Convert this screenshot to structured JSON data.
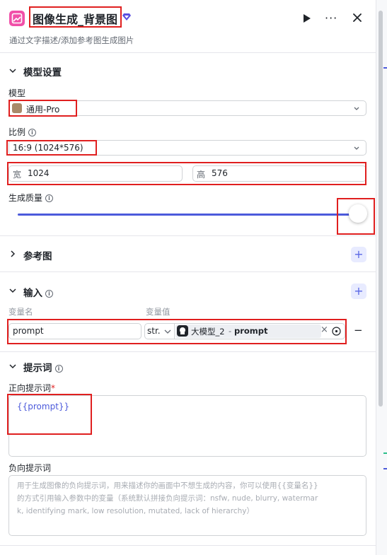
{
  "header": {
    "title": "图像生成_背景图",
    "subtitle": "通过文字描述/添加参考图生成图片",
    "more_glyph": "···",
    "icons": [
      "image-node-icon",
      "diamond-icon",
      "play-icon",
      "more-icon",
      "close-icon"
    ]
  },
  "model_settings": {
    "title": "模型设置",
    "model_label": "模型",
    "model_value": "通用-Pro",
    "ratio_label": "比例",
    "ratio_value": "16:9 (1024*576)",
    "width_label": "宽",
    "width_value": "1024",
    "height_label": "高",
    "height_value": "576",
    "quality_label": "生成质量",
    "quality_level": 1.0
  },
  "reference": {
    "title": "参考图",
    "add_glyph": "+"
  },
  "input": {
    "title": "输入",
    "add_glyph": "+",
    "col_name": "变量名",
    "col_value": "变量值",
    "row": {
      "name": "prompt",
      "type": "str.",
      "source_node": "大模型_2",
      "source_sep": "-",
      "source_var": "prompt",
      "clear_glyph": "×",
      "remove_glyph": "−"
    }
  },
  "prompt": {
    "title": "提示词",
    "positive_label": "正向提示词",
    "required_mark": "*",
    "positive_value": "{{prompt}}",
    "negative_label": "负向提示词",
    "negative_placeholder_line1": "用于生成图像的负向提示词，用来描述你的画面中不想生成的内容，你可以使用{{变量名}}",
    "negative_placeholder_line2": "的方式引用输入参数中的变量（系统默认拼接负向提示词：nsfw, nude, blurry, watermar",
    "negative_placeholder_line3": "k, identifying mark, low resolution, mutated, lack of hierarchy）"
  },
  "colors": {
    "accent": "#4c5adb",
    "node_icon": "#f04fa8",
    "annotation": "#e01f1f"
  }
}
